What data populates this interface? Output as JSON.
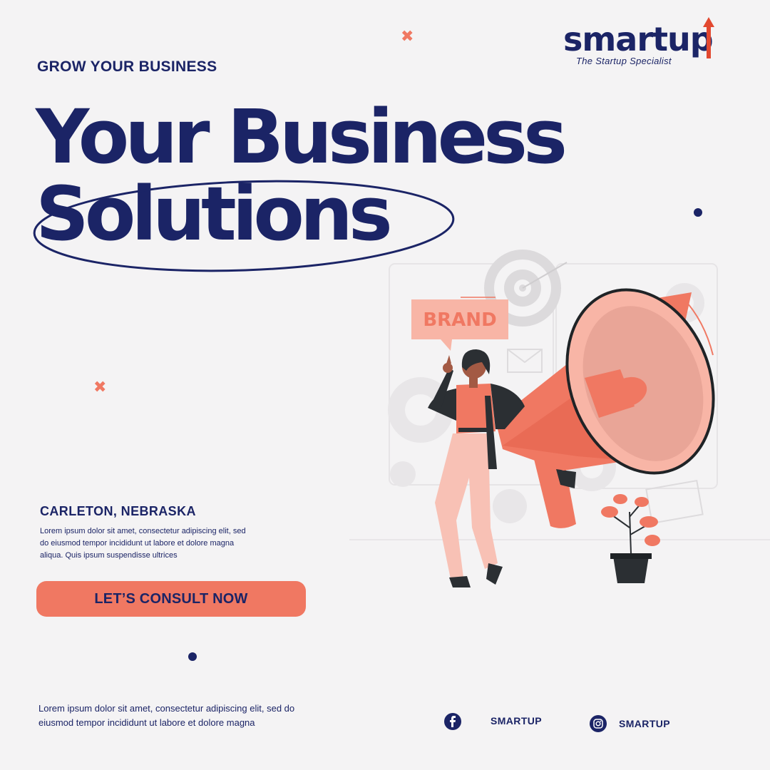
{
  "brand": {
    "name": "smartup",
    "tagline": "The Startup Specialist"
  },
  "eyebrow": "GROW YOUR BUSINESS",
  "headline": {
    "line1": "Your Business",
    "line2": "Solutions"
  },
  "illustration": {
    "sign_text": "BRAND"
  },
  "location": "CARLETON, NEBRASKA",
  "description": "Lorem ipsum dolor sit amet, consectetur adipiscing elit, sed do eiusmod tempor incididunt ut labore et dolore magna aliqua. Quis ipsum suspendisse ultrices",
  "cta_label": "LET’S CONSULT NOW",
  "footer_text": "Lorem ipsum dolor sit amet, consectetur adipiscing elit, sed do eiusmod tempor incididunt ut labore et dolore magna",
  "social": [
    {
      "icon": "facebook-icon",
      "label": "SMARTUP"
    },
    {
      "icon": "instagram-icon",
      "label": "SMARTUP"
    }
  ],
  "colors": {
    "navy": "#1b2466",
    "coral": "#f07862",
    "peach": "#f8b5a6",
    "background": "#f4f3f4"
  }
}
